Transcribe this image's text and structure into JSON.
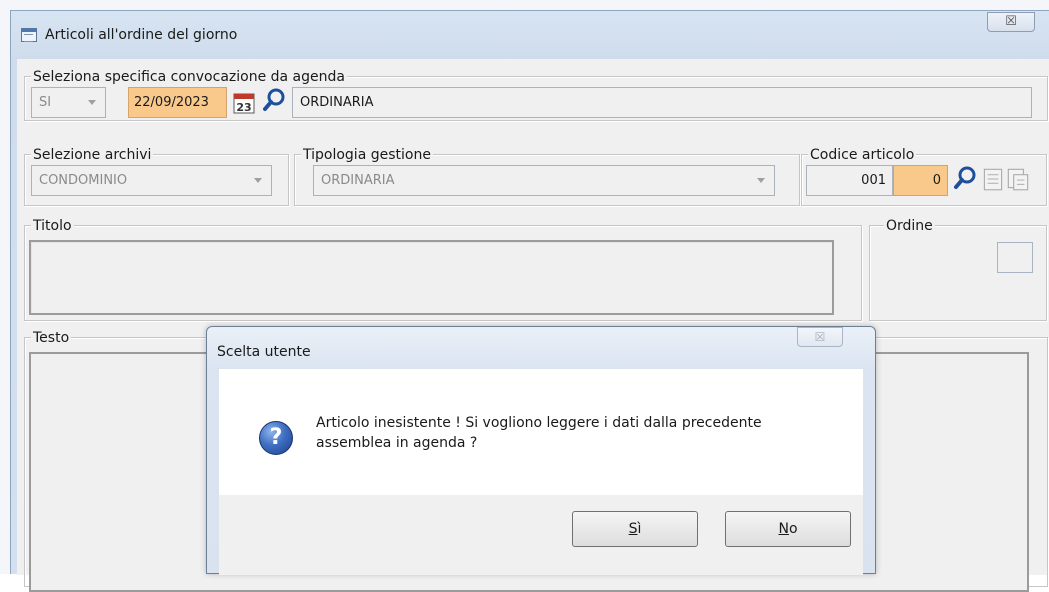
{
  "window": {
    "title": "Articoli all'ordine del giorno",
    "close_label": "☒"
  },
  "convocazione": {
    "group_label": "Seleziona specifica convocazione da agenda",
    "si_value": "SI",
    "date_value": "22/09/2023",
    "calendar_day": "23",
    "type_value": "ORDINARIA"
  },
  "archivi": {
    "group_label": "Selezione archivi",
    "value": "CONDOMINIO"
  },
  "tipologia": {
    "group_label": "Tipologia gestione",
    "value": "ORDINARIA"
  },
  "codice": {
    "group_label": "Codice articolo",
    "code_value": "001",
    "sub_value": "0"
  },
  "titolo": {
    "group_label": "Titolo",
    "value": ""
  },
  "ordine": {
    "group_label": "Ordine",
    "value": ""
  },
  "testo": {
    "group_label": "Testo",
    "value": ""
  },
  "dialog": {
    "title": "Scelta utente",
    "close_label": "☒",
    "message": "Articolo inesistente ! Si vogliono leggere i dati dalla precedente assemblea in agenda ?",
    "yes_mnemonic": "S",
    "yes_rest": "ì",
    "no_mnemonic": "N",
    "no_rest": "o",
    "icon": "question-icon"
  },
  "colors": {
    "date_highlight": "#f9c98c",
    "window_frame": "#d3e0ef",
    "panel": "#f0f0f0",
    "search_icon": "#1e4f9c"
  }
}
